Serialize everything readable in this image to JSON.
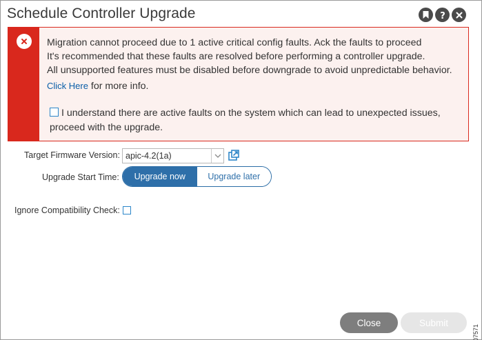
{
  "dialog": {
    "title": "Schedule Controller Upgrade",
    "header_icons": [
      "bookmark-icon",
      "help-icon",
      "close-icon"
    ]
  },
  "alert": {
    "lines": [
      "Migration cannot proceed due to 1 active critical config faults. Ack the faults to proceed",
      "It's recommended that these faults are resolved before performing a controller upgrade.",
      "All unsupported features must be disabled before downgrade to avoid unpredictable behavior."
    ],
    "link_label": "Click Here",
    "link_suffix": " for more info.",
    "acknowledge_line1": "I understand there are active faults on the system which can lead to unexpected issues,",
    "acknowledge_line2": "proceed with the upgrade.",
    "acknowledge_checked": false,
    "color": "#d9281d"
  },
  "form": {
    "firmware_label": "Target Firmware Version:",
    "firmware_value": "apic-4.2(1a)",
    "start_time_label": "Upgrade Start Time:",
    "start_time_options": [
      "Upgrade now",
      "Upgrade later"
    ],
    "start_time_selected": "Upgrade now",
    "ignore_compat_label": "Ignore Compatibility Check:",
    "ignore_compat_checked": false
  },
  "footer": {
    "close_label": "Close",
    "submit_label": "Submit",
    "submit_enabled": false
  },
  "figure_id": "307571",
  "accent_color": "#2e6fa9"
}
